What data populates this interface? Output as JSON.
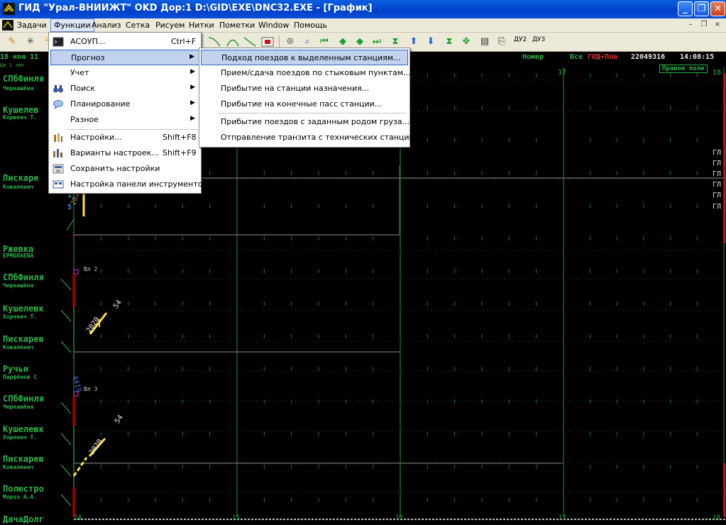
{
  "window": {
    "title": "ГИД \"Урал-ВНИИЖТ\" OKD Дор:1 D:\\GID\\EXE\\DNC32.EXE - [График]",
    "controls": {
      "minimize": "_",
      "maximize": "❐",
      "close": "✕"
    }
  },
  "menubar": {
    "items": [
      "Задачи",
      "Функции",
      "Анализ",
      "Сетка",
      "Рисуем",
      "Нитки",
      "Пометки",
      "Window",
      "Помощь"
    ],
    "active": "Функции",
    "mdi": [
      "–",
      "❐",
      "×"
    ]
  },
  "toolbar": {
    "du2": "ДУ2",
    "du3": "ДУ3"
  },
  "graph": {
    "date": "18 ноя 11",
    "subheader": "Цв 1 тип",
    "nomer": "Номер",
    "vse": "Все",
    "gid_pla": "ГИД+Пла",
    "code": "22049316",
    "time": "14:08:15",
    "right_field": "Правое поле",
    "hour_labels": [
      "14",
      "15",
      "16",
      "17",
      "18"
    ],
    "bottom_hours": [
      "14",
      "15",
      "16",
      "17",
      "18"
    ],
    "section_labels": [
      "Вл 2",
      "Вл 3"
    ],
    "right_gl": [
      "ГЛ",
      "ГЛ",
      "ГЛ",
      "ГЛ",
      "ГЛ",
      "ГЛ"
    ],
    "track_digits": [
      "1",
      "5"
    ],
    "train_labels": {
      "a": "2020",
      "b": "2020",
      "b2": "54",
      "c": "4419",
      "d": "2020",
      "d2": "54"
    },
    "stations": [
      {
        "name": "СПбФинля",
        "operator": "Черкашёна"
      },
      {
        "name": "Кушелев",
        "operator": "Корвеич Т."
      },
      {
        "name": "Пискаре",
        "operator": "Коваленич"
      },
      {
        "name": "Ржевка",
        "operator": "ЕРМОЛАЕВА"
      },
      {
        "name": "СПбФинля",
        "operator": "Черкашёна"
      },
      {
        "name": "Кушелевк",
        "operator": "Хоренич Т."
      },
      {
        "name": "Пискарев",
        "operator": "Коваленич"
      },
      {
        "name": "Ручьи",
        "operator": "Парфёнов С"
      },
      {
        "name": "СПбФинля",
        "operator": "Черкашёна"
      },
      {
        "name": "Кушелевк",
        "operator": "Хоренич Т."
      },
      {
        "name": "Пискарев",
        "operator": "Коваленич"
      },
      {
        "name": "Полюстро",
        "operator": "Мороз А.А."
      },
      {
        "name": "ДачаДолг",
        "operator": ""
      }
    ]
  },
  "functions_menu": {
    "items": [
      {
        "label": "АСОУП...",
        "shortcut": "Ctrl+F",
        "icon": "terminal-icon"
      },
      {
        "label": "Прогноз",
        "submenu": true,
        "highlighted": true
      },
      {
        "label": "Учет",
        "submenu": true
      },
      {
        "label": "Поиск",
        "submenu": true,
        "icon": "binoculars-icon"
      },
      {
        "label": "Планирование",
        "submenu": true,
        "icon": "chat-icon"
      },
      {
        "label": "Разное",
        "submenu": true
      },
      {
        "label": "Настройки...",
        "shortcut": "Shift+F8",
        "icon": "settings-icon"
      },
      {
        "label": "Варианты настроек...",
        "shortcut": "Shift+F9",
        "icon": "settings-variants-icon"
      },
      {
        "label": "Сохранить настройки",
        "icon": "save-settings-icon"
      },
      {
        "label": "Настройка панели инструментов",
        "icon": "toolbar-settings-icon"
      }
    ]
  },
  "forecast_submenu": {
    "items": [
      "Подход поездов к выделенным станциям...",
      "Прием/сдача поездов по стыковым пунктам...",
      "Прибытие на станции назначения...",
      "Прибытие на конечные пасс станции...",
      "Прибытие поездов с заданным родом груза...",
      "Отправление транзита с технических станций..."
    ],
    "highlighted_index": 0
  }
}
